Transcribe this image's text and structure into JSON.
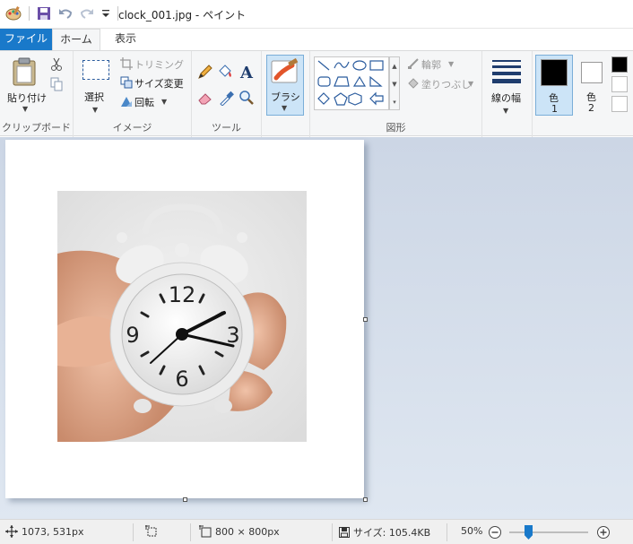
{
  "window": {
    "title": "clock_001.jpg - ペイント"
  },
  "tabs": {
    "file": "ファイル",
    "home": "ホーム",
    "view": "表示"
  },
  "clipboard": {
    "paste": "貼り付け",
    "group": "クリップボード"
  },
  "image": {
    "select": "選択",
    "crop": "トリミング",
    "resize": "サイズ変更",
    "rotate": "回転",
    "group": "イメージ"
  },
  "tools": {
    "group": "ツール"
  },
  "brushes": {
    "label": "ブラシ"
  },
  "shapes": {
    "outline": "輪郭",
    "fill": "塗りつぶし",
    "group": "図形"
  },
  "size": {
    "label": "線の幅"
  },
  "colors": {
    "color1_label": "色",
    "color1_num": "1",
    "color2_label": "色",
    "color2_num": "2",
    "color1": "#000000",
    "color2": "#ffffff",
    "accent": "#1979ca"
  },
  "canvas_image": {
    "clock_numerals": [
      "12",
      "3",
      "6",
      "9"
    ]
  },
  "status": {
    "cursor_pos": "1073, 531px",
    "image_size": "800 × 800px",
    "file_size": "サイズ: 105.4KB",
    "zoom": "50%"
  },
  "icons": [
    "paint-app-icon",
    "save-icon",
    "undo-icon",
    "redo-icon",
    "customize-qat-icon",
    "paste-icon",
    "cut-icon",
    "copy-icon",
    "select-icon",
    "crop-icon",
    "resize-icon",
    "rotate-icon",
    "pencil-icon",
    "fill-icon",
    "text-icon",
    "eraser-icon",
    "color-picker-icon",
    "magnifier-icon",
    "brush-icon",
    "move-cursor-icon",
    "selection-size-icon",
    "image-size-icon",
    "disk-icon",
    "zoom-out-icon",
    "zoom-in-icon"
  ]
}
